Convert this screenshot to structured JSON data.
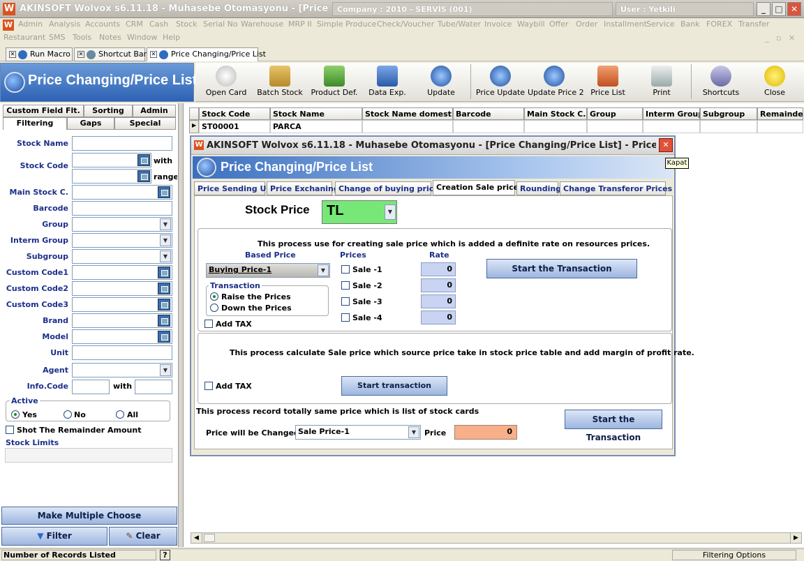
{
  "window": {
    "title": "AKINSOFT Wolvox s6.11.18 - Muhasebe Otomasyonu - [Price Changing/P",
    "company": "Company : 2010 - SERVİS (001)",
    "user": "User : Yetkili"
  },
  "menu": {
    "row1": [
      "Admin",
      "Analysis",
      "Accounts",
      "CRM",
      "Cash",
      "Stock",
      "Serial No",
      "Warehouse",
      "MRP II",
      "Simple Produce",
      "Check/Voucher",
      "Tube/Water",
      "Invoice",
      "Waybill",
      "Offer",
      "Order",
      "Installment",
      "Service",
      "Bank",
      "FOREX",
      "Transfer"
    ],
    "row2": [
      "Restaurant",
      "SMS",
      "Tools",
      "Notes",
      "Window",
      "Help"
    ]
  },
  "doc_tabs": [
    "Run Macro",
    "Shortcut Bar",
    "Price Changing/Price List"
  ],
  "header": {
    "title": "Price Changing/Price List"
  },
  "toolbar": [
    "Open Card",
    "Batch Stock",
    "Product Def.",
    "Data Exp.",
    "Update",
    "Price Update",
    "Update Price 2",
    "Price List",
    "Print",
    "Shortcuts",
    "Close"
  ],
  "left": {
    "tabs_row1": [
      "Custom Field Flt.",
      "Sorting",
      "Admin"
    ],
    "tabs_row2": [
      "Filtering",
      "Gaps",
      "Special"
    ],
    "labels": {
      "stock_name": "Stock Name",
      "stock_code": "Stock Code",
      "with": "with",
      "range": "range",
      "main_stock": "Main Stock C.",
      "barcode": "Barcode",
      "group": "Group",
      "interm_group": "Interm Group",
      "subgroup": "Subgroup",
      "cc1": "Custom Code1",
      "cc2": "Custom Code2",
      "cc3": "Custom Code3",
      "brand": "Brand",
      "model": "Model",
      "unit": "Unit",
      "agent": "Agent",
      "info_code": "Info.Code",
      "info_with": "with"
    },
    "active": {
      "title": "Active",
      "yes": "Yes",
      "no": "No",
      "all": "All"
    },
    "shot_remainder": "Shot The Remainder Amount",
    "stock_limits": "Stock Limits",
    "make_multiple": "Make Multiple Choose",
    "filter": "Filter",
    "clear": "Clear"
  },
  "grid": {
    "columns": [
      "Stock Code",
      "Stock Name",
      "Stock Name domestic",
      "Barcode",
      "Main Stock C.",
      "Group",
      "Interm Group",
      "Subgroup",
      "Remainder"
    ],
    "row": {
      "code": "ST00001",
      "name": "PARCA"
    }
  },
  "dialog": {
    "title": "AKINSOFT Wolvox s6.11.18 - Muhasebe Otomasyonu - [Price Changing/Price List] - Price Changing/Pr...",
    "banner": "Price Changing/Price List",
    "tabs": [
      "Price Sending Up",
      "Price Exchaning",
      "Change of buying price",
      "Creation Sale price",
      "Rounding",
      "Change Transferor Prices"
    ],
    "stock_price_label": "Stock Price",
    "stock_price_value": "TL",
    "sec1": {
      "desc": "This process use for creating sale price which is added a definite rate on resources prices.",
      "based_price": "Based Price",
      "prices": "Prices",
      "rate": "Rate",
      "based_value": "Buying Price-1",
      "transaction": "Transaction",
      "raise": "Raise the Prices",
      "down": "Down the Prices",
      "add_tax": "Add TAX",
      "sales": [
        "Sale -1",
        "Sale -2",
        "Sale -3",
        "Sale -4"
      ],
      "rates": [
        "0",
        "0",
        "0",
        "0"
      ],
      "start": "Start the Transaction"
    },
    "sec2": {
      "desc": "This process calculate Sale price which source price take in stock price table and add margin of profit rate.",
      "add_tax": "Add TAX",
      "start": "Start transaction"
    },
    "sec3": {
      "desc": "This process record totally same price which is list of stock cards",
      "changed_label": "Price will be Changed",
      "changed_value": "Sale Price-1",
      "price_label": "Price",
      "price_value": "0",
      "start": "Start the Transaction"
    }
  },
  "tooltip": "Kapat",
  "status": {
    "left": "Number of Records Listed",
    "help": "?",
    "right": "Filtering Options"
  },
  "colors": {
    "accent": "#2d62b4",
    "stock_price_bg": "#77e877",
    "price_bg": "#f7b08a"
  }
}
